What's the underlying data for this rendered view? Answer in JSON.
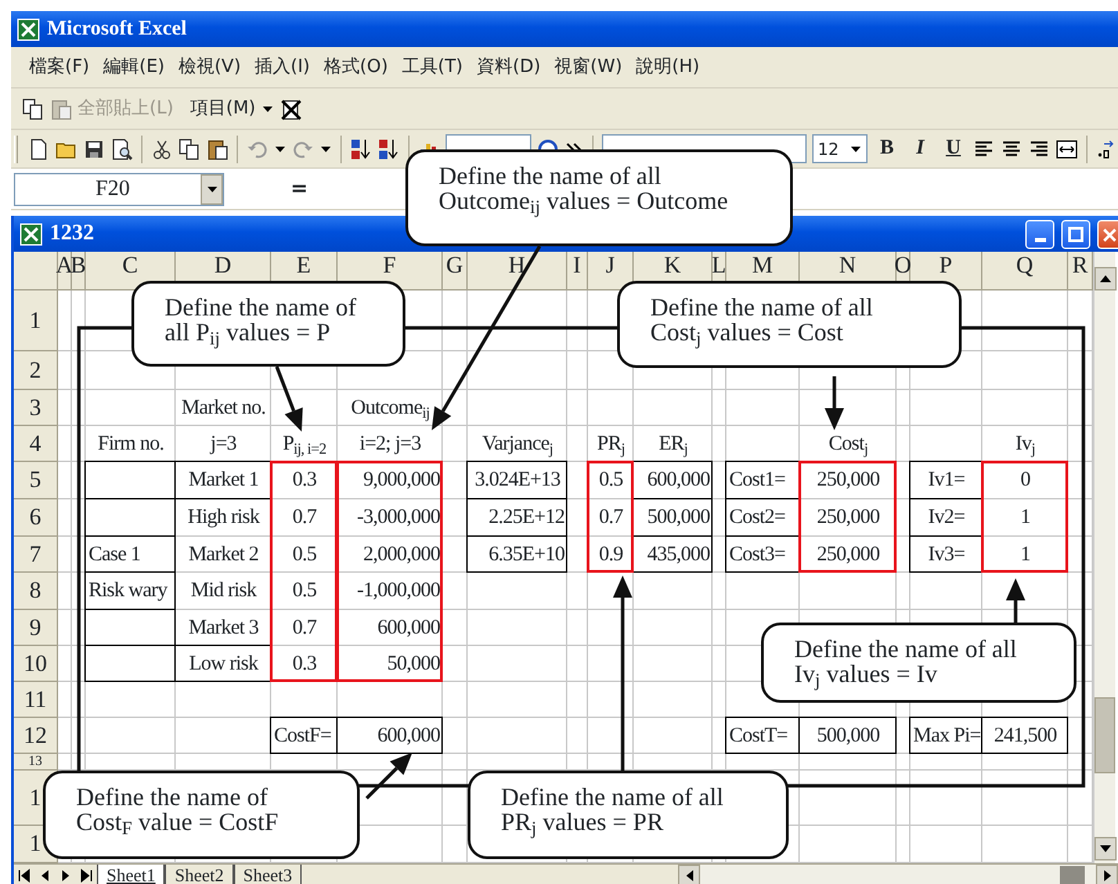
{
  "app": {
    "title": "Microsoft Excel"
  },
  "menu": [
    "檔案(F)",
    "編輯(E)",
    "檢視(V)",
    "插入(I)",
    "格式(O)",
    "工具(T)",
    "資料(D)",
    "視窗(W)",
    "說明(H)"
  ],
  "clipboard_toolbar": {
    "paste_all": {
      "label": "全部貼上(L)",
      "disabled": true
    },
    "items": "項目(M)"
  },
  "format_toolbar": {
    "font_size": "12",
    "style_buttons": [
      "B",
      "I",
      "U"
    ]
  },
  "formula_bar": {
    "name_box": "F20",
    "equals": "="
  },
  "workbook": {
    "title": "1232"
  },
  "sheet": {
    "columns": [
      "A",
      "B",
      "C",
      "D",
      "E",
      "F",
      "G",
      "H",
      "I",
      "J",
      "K",
      "L",
      "M",
      "N",
      "O",
      "P",
      "Q",
      "R"
    ],
    "rows": [
      {
        "label": "1"
      },
      {
        "label": "2"
      },
      {
        "label": "3",
        "cells": [
          "",
          "",
          "",
          {
            "text": "Market no.",
            "kind": "label"
          },
          "",
          {
            "text": "Outcome$_{ij}$",
            "kind": "label"
          }
        ]
      },
      {
        "label": "4",
        "cells": [
          "",
          "",
          {
            "text": "Firm no.",
            "kind": "label"
          },
          {
            "text": "j=3",
            "kind": "label"
          },
          {
            "text": "P$_{ij, i=2}$",
            "kind": "label"
          },
          {
            "text": "i=2; j=3",
            "kind": "label"
          },
          "",
          {
            "text": "Varjance$_{j}$",
            "kind": "label"
          },
          "",
          {
            "text": "PR$_{j}$",
            "kind": "label"
          },
          {
            "text": "ER$_{j}$",
            "kind": "label"
          },
          "",
          "",
          {
            "text": "Cost$_{j}$",
            "kind": "label"
          },
          "",
          "",
          {
            "text": "Iv$_{j}$",
            "kind": "label"
          }
        ]
      },
      {
        "label": "5",
        "cells": [
          "",
          "",
          {
            "border": true
          },
          {
            "text": "Market 1",
            "kind": "label",
            "border": true
          },
          {
            "text": "0.3",
            "kind": "label",
            "highlighted": true
          },
          {
            "text": "9,000,000",
            "kind": "number",
            "highlighted": true
          },
          "",
          {
            "text": "3.024E+13",
            "kind": "label",
            "border": true
          },
          "",
          {
            "text": "0.5",
            "kind": "label",
            "highlighted": true
          },
          {
            "text": "600,000",
            "kind": "number",
            "border": true
          },
          "",
          {
            "text": "Cost1=",
            "kind": "caption",
            "border": true
          },
          {
            "text": "250,000",
            "kind": "label",
            "highlighted": true
          },
          "",
          {
            "text": "Iv1=",
            "kind": "label",
            "border": true
          },
          {
            "text": "0",
            "kind": "label",
            "highlighted": true
          }
        ]
      },
      {
        "label": "6",
        "cells": [
          "",
          "",
          {
            "border": true
          },
          {
            "text": "High risk",
            "kind": "label"
          },
          {
            "text": "0.7",
            "kind": "label",
            "highlighted": true
          },
          {
            "text": "-3,000,000",
            "kind": "number",
            "highlighted": true
          },
          "",
          {
            "text": "2.25E+12",
            "kind": "number",
            "border": true
          },
          "",
          {
            "text": "0.7",
            "kind": "label",
            "highlighted": true
          },
          {
            "text": "500,000",
            "kind": "number",
            "border": true
          },
          "",
          {
            "text": "Cost2=",
            "kind": "caption",
            "border": true
          },
          {
            "text": "250,000",
            "kind": "label",
            "highlighted": true
          },
          "",
          {
            "text": "Iv2=",
            "kind": "label",
            "border": true
          },
          {
            "text": "1",
            "kind": "label",
            "highlighted": true
          }
        ]
      },
      {
        "label": "7",
        "cells": [
          "",
          "",
          {
            "text": "Case 1",
            "kind": "caption",
            "border": true
          },
          {
            "text": "Market 2",
            "kind": "label"
          },
          {
            "text": "0.5",
            "kind": "label",
            "highlighted": true
          },
          {
            "text": "2,000,000",
            "kind": "number",
            "highlighted": true
          },
          "",
          {
            "text": "6.35E+10",
            "kind": "number",
            "border": true
          },
          "",
          {
            "text": "0.9",
            "kind": "label",
            "highlighted": true
          },
          {
            "text": "435,000",
            "kind": "number",
            "border": true
          },
          "",
          {
            "text": "Cost3=",
            "kind": "caption",
            "border": true
          },
          {
            "text": "250,000",
            "kind": "label",
            "highlighted": true
          },
          "",
          {
            "text": "Iv3=",
            "kind": "label",
            "border": true
          },
          {
            "text": "1",
            "kind": "label",
            "highlighted": true
          }
        ]
      },
      {
        "label": "8",
        "cells": [
          "",
          "",
          {
            "text": "Risk wary",
            "kind": "caption",
            "border": true
          },
          {
            "text": "Mid risk",
            "kind": "label"
          },
          {
            "text": "0.5",
            "kind": "label",
            "highlighted": true
          },
          {
            "text": "-1,000,000",
            "kind": "number",
            "highlighted": true
          }
        ]
      },
      {
        "label": "9",
        "cells": [
          "",
          "",
          {
            "border": true
          },
          {
            "text": "Market 3",
            "kind": "label"
          },
          {
            "text": "0.7",
            "kind": "label",
            "highlighted": true
          },
          {
            "text": "600,000",
            "kind": "number",
            "highlighted": true
          }
        ]
      },
      {
        "label": "10",
        "cells": [
          "",
          "",
          {
            "border": true
          },
          {
            "text": "Low risk",
            "kind": "label",
            "border": true
          },
          {
            "text": "0.3",
            "kind": "label",
            "highlighted": true
          },
          {
            "text": "50,000",
            "kind": "number",
            "highlighted": true
          }
        ]
      },
      {
        "label": "11"
      },
      {
        "label": "12",
        "cells": [
          "",
          "",
          "",
          "",
          {
            "text": "CostF=",
            "kind": "caption",
            "border": true
          },
          {
            "text": "600,000",
            "kind": "number",
            "border": true
          },
          "",
          "",
          "",
          "",
          "",
          "",
          {
            "text": "CostT=",
            "kind": "caption",
            "border": true
          },
          {
            "text": "500,000",
            "kind": "label",
            "border": true
          },
          "",
          {
            "text": "Max Pi=",
            "kind": "caption",
            "border": true
          },
          {
            "text": "241,500",
            "kind": "label",
            "border": true
          }
        ]
      },
      {
        "label": "13"
      },
      {
        "label": "1"
      },
      {
        "label": "1"
      }
    ]
  },
  "callouts": [
    {
      "lines": [
        "Define the name of all",
        "Outcome$_{ij}$ values = Outcome"
      ]
    },
    {
      "lines": [
        "Define the name of",
        "all P$_{ij}$ values = P"
      ]
    },
    {
      "lines": [
        "Define the name of all",
        "Cost$_{j}$ values = Cost"
      ]
    },
    {
      "lines": [
        "Define the name of all",
        "Iv$_{j}$ values = Iv"
      ]
    },
    {
      "lines": [
        "Define the name of",
        "Cost$_{F}$ value = CostF"
      ]
    },
    {
      "lines": [
        "Define the name of all",
        "PR$_{j}$ values = PR"
      ]
    }
  ],
  "sheet_tabs": [
    {
      "label": "Sheet1",
      "selected": true
    },
    {
      "label": "Sheet2",
      "selected": false
    },
    {
      "label": "Sheet3",
      "selected": false
    }
  ]
}
